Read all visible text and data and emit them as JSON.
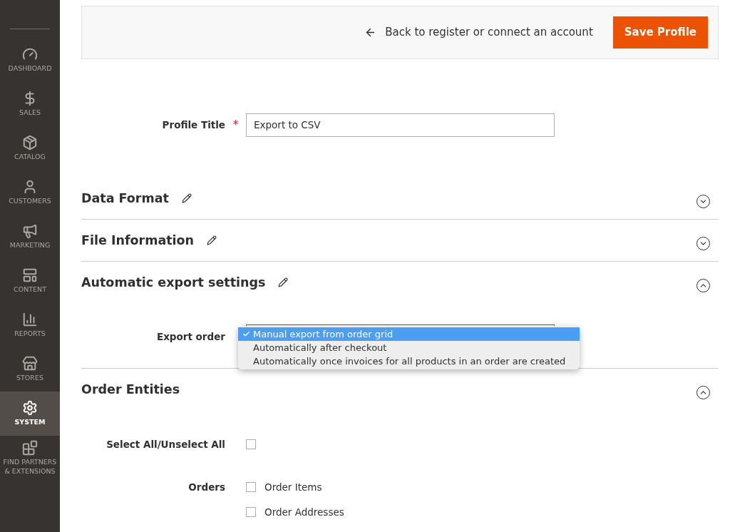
{
  "sidebar": {
    "items": [
      {
        "label": "DASHBOARD",
        "selected": false
      },
      {
        "label": "SALES",
        "selected": false
      },
      {
        "label": "CATALOG",
        "selected": false
      },
      {
        "label": "CUSTOMERS",
        "selected": false
      },
      {
        "label": "MARKETING",
        "selected": false
      },
      {
        "label": "CONTENT",
        "selected": false
      },
      {
        "label": "REPORTS",
        "selected": false
      },
      {
        "label": "STORES",
        "selected": false
      },
      {
        "label": "SYSTEM",
        "selected": true
      },
      {
        "label": "FIND PARTNERS & EXTENSIONS",
        "selected": false
      }
    ]
  },
  "header": {
    "back_link": "Back to register or connect an account",
    "save_button": "Save Profile"
  },
  "profile_title": {
    "label": "Profile Title",
    "required_mark": "*",
    "value": "Export to CSV"
  },
  "sections": [
    {
      "title": "Data Format",
      "editable": true,
      "expanded": false
    },
    {
      "title": "File Information",
      "editable": true,
      "expanded": false
    },
    {
      "title": "Automatic export settings",
      "editable": true,
      "expanded": true,
      "kind": "dropdown",
      "field": {
        "label": "Export order",
        "open": true,
        "options": [
          {
            "label": "Manual export from order grid",
            "selected": true
          },
          {
            "label": "Automatically after checkout",
            "selected": false
          },
          {
            "label": "Automatically once invoices for all products in an order are created",
            "selected": false
          }
        ]
      }
    },
    {
      "title": "Order Entities",
      "editable": false,
      "expanded": true,
      "kind": "entities",
      "select_all": {
        "label": "Select All/Unselect All",
        "checked": false
      },
      "groups": [
        {
          "label": "Orders",
          "options": [
            {
              "label": "Order Items",
              "checked": false
            },
            {
              "label": "Order Addresses",
              "checked": false
            }
          ]
        }
      ]
    }
  ]
}
